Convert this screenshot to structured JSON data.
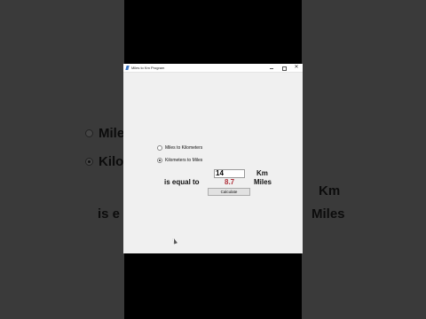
{
  "window": {
    "title": "Miles to Km Program",
    "minimize": "",
    "maximize": "",
    "close": "✕"
  },
  "options": [
    {
      "label": "Miles to Kilometers",
      "selected": false
    },
    {
      "label": "Kilometers to Miles",
      "selected": true
    }
  ],
  "converter": {
    "input_value": "14",
    "input_unit": "Km",
    "equal_label": "is equal to",
    "result_value": "8.7",
    "result_unit": "Miles",
    "calculate_label": "Calculate"
  },
  "background": {
    "left_option_1": "Miles",
    "left_option_2": "Kilom",
    "left_equal": "is e",
    "right_unit": "Km",
    "right_result_unit": "Miles"
  },
  "colors": {
    "result": "#b0303a",
    "window_bg": "#f0f0f0",
    "title_bg": "#ffffff"
  }
}
